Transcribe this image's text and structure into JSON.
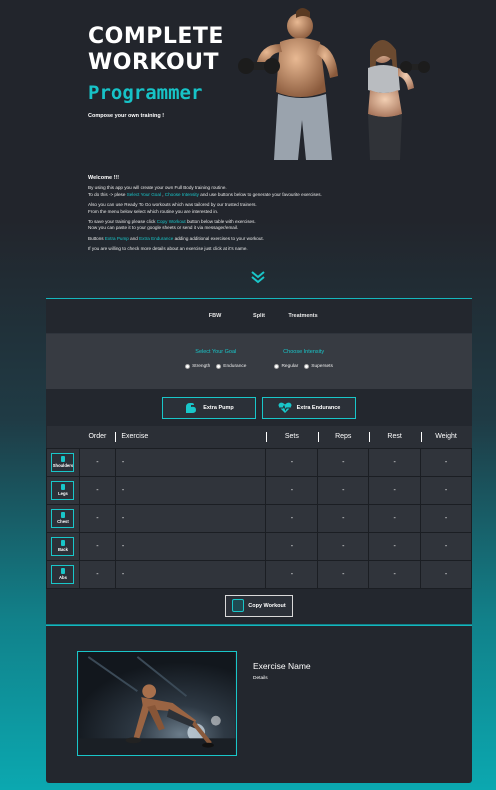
{
  "hero": {
    "title_line1": "COMPLETE",
    "title_line2": "WORKOUT",
    "subtitle": "Programmer",
    "tagline": "Compose your own training !"
  },
  "intro": {
    "welcome": "Welcome !!!",
    "p1_a": "By using this app you will create your own Full Body training routine.",
    "p1_b1": "To do this -> plese ",
    "p1_goal": "Select Your Goal",
    "p1_b2": " , ",
    "p1_int": "Choose Intensity",
    "p1_b3": " and use buttons below to generate your favourite exercises.",
    "p2_a": "Also you can use Ready To Go workouts which was tailored by our trusted trainers.",
    "p2_b": "From the menu below select which routine you are interested in.",
    "p3_a1": "To save your training please click ",
    "p3_copy": "Copy Workout",
    "p3_a2": " button below table with exercises.",
    "p3_b": "Now you can paste it to your google sheets or send it via messager/email.",
    "p4_a": "Buttons ",
    "p4_pump": "Extra Pump",
    "p4_and": " and ",
    "p4_end": "Extra Endurance",
    "p4_b": " adding additional exercises to your workout.",
    "p5": "If you are willing to check more details about an exercise just click at it's name."
  },
  "tabs": [
    "FBW",
    "Split",
    "Treatments"
  ],
  "goal": {
    "title": "Select Your Goal",
    "options": [
      "Strength",
      "Endurance"
    ]
  },
  "intensity": {
    "title": "Choose Intensity",
    "options": [
      "Regular",
      "Supersets"
    ]
  },
  "extras": {
    "pump_label": "Extra Pump",
    "endurance_label": "Extra Endurance"
  },
  "table": {
    "headers": [
      "Order",
      "Exercise",
      "Sets",
      "Reps",
      "Rest",
      "Weight"
    ],
    "rows": [
      {
        "muscle": "Shoulders",
        "order": "-",
        "exercise": "-",
        "sets": "-",
        "reps": "-",
        "rest": "-",
        "weight": "-"
      },
      {
        "muscle": "Legs",
        "order": "-",
        "exercise": "-",
        "sets": "-",
        "reps": "-",
        "rest": "-",
        "weight": "-"
      },
      {
        "muscle": "Chest",
        "order": "-",
        "exercise": "-",
        "sets": "-",
        "reps": "-",
        "rest": "-",
        "weight": "-"
      },
      {
        "muscle": "Back",
        "order": "-",
        "exercise": "-",
        "sets": "-",
        "reps": "-",
        "rest": "-",
        "weight": "-"
      },
      {
        "muscle": "Abs",
        "order": "-",
        "exercise": "-",
        "sets": "-",
        "reps": "-",
        "rest": "-",
        "weight": "-"
      }
    ]
  },
  "copy_label": "Copy Workout",
  "details": {
    "name": "Exercise Name",
    "text": "Details"
  },
  "colors": {
    "accent": "#19c6c9",
    "dark": "#22252c",
    "panel": "#23272e"
  }
}
